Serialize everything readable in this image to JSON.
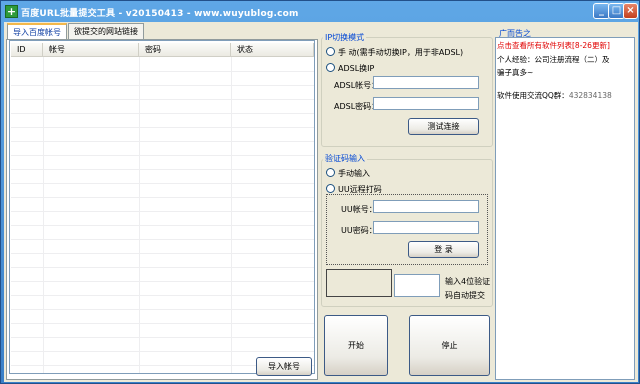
{
  "window": {
    "title": "百度URL批量提交工具 - v20150413 - www.wuyublog.com",
    "icon": "plus-icon",
    "controls": {
      "minimize": "_",
      "maximize": "□",
      "close": "×"
    }
  },
  "tabs": [
    {
      "label": "导入百度帐号",
      "active": true
    },
    {
      "label": "欲提交的网站链接",
      "active": false
    }
  ],
  "table": {
    "columns": [
      "ID",
      "帐号",
      "密码",
      "状态"
    ],
    "rows": []
  },
  "import_button": "导入帐号",
  "ip_group": {
    "title": "IP切换模式",
    "options": [
      {
        "label": "手 动(需手动切换IP，用于非ADSL)",
        "selected": false
      },
      {
        "label": "ADSL换IP",
        "selected": false
      }
    ],
    "adsl_account_label": "ADSL帐号：",
    "adsl_account_value": "",
    "adsl_password_label": "ADSL密码：",
    "adsl_password_value": "",
    "test_button": "测试连接"
  },
  "captcha_group": {
    "title": "验证码输入",
    "options": [
      {
        "label": "手动输入",
        "selected": false
      },
      {
        "label": "UU远程打码",
        "selected": false
      }
    ],
    "uu_account_label": "UU帐号：",
    "uu_account_value": "",
    "uu_password_label": "UU密码：",
    "uu_password_value": "",
    "login_button": "登  录",
    "code_value": "",
    "hint_line1": "输入4位验证",
    "hint_line2": "码自动提交"
  },
  "start_button": "开始",
  "stop_button": "停止",
  "ad": {
    "title": "广而告之",
    "line1": "点击查看所有软件列表[8-26更新]",
    "line2": "个人经验：公司注册流程（二）及",
    "line3": "骗子真多~",
    "line4_label": "软件使用交流QQ群：",
    "line4_value": "432834138"
  },
  "colors": {
    "title_bar": "#3a80c8",
    "window_bg": "#ece9d8",
    "group_title": "#0046d5",
    "ad_link": "#e00000",
    "qq_number": "#666666"
  }
}
